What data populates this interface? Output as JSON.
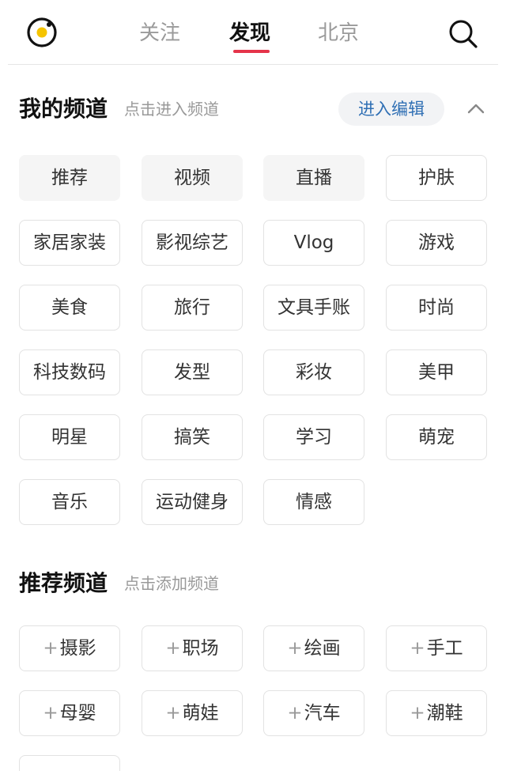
{
  "header": {
    "tabs": [
      {
        "label": "关注",
        "active": false
      },
      {
        "label": "发现",
        "active": true
      },
      {
        "label": "北京",
        "active": false
      }
    ],
    "accent_color": "#e5344a",
    "logo_color": "#f5c400"
  },
  "my_channels": {
    "title": "我的频道",
    "hint": "点击进入频道",
    "edit_label": "进入编辑",
    "channels": [
      {
        "label": "推荐",
        "filled": true
      },
      {
        "label": "视频",
        "filled": true
      },
      {
        "label": "直播",
        "filled": true
      },
      {
        "label": "护肤",
        "filled": false
      },
      {
        "label": "家居家装",
        "filled": false
      },
      {
        "label": "影视综艺",
        "filled": false
      },
      {
        "label": "Vlog",
        "filled": false
      },
      {
        "label": "游戏",
        "filled": false
      },
      {
        "label": "美食",
        "filled": false
      },
      {
        "label": "旅行",
        "filled": false
      },
      {
        "label": "文具手账",
        "filled": false
      },
      {
        "label": "时尚",
        "filled": false
      },
      {
        "label": "科技数码",
        "filled": false
      },
      {
        "label": "发型",
        "filled": false
      },
      {
        "label": "彩妆",
        "filled": false
      },
      {
        "label": "美甲",
        "filled": false
      },
      {
        "label": "明星",
        "filled": false
      },
      {
        "label": "搞笑",
        "filled": false
      },
      {
        "label": "学习",
        "filled": false
      },
      {
        "label": "萌宠",
        "filled": false
      },
      {
        "label": "音乐",
        "filled": false
      },
      {
        "label": "运动健身",
        "filled": false
      },
      {
        "label": "情感",
        "filled": false
      }
    ]
  },
  "recommended_channels": {
    "title": "推荐频道",
    "hint": "点击添加频道",
    "plus": "+",
    "channels": [
      {
        "label": "摄影"
      },
      {
        "label": "职场"
      },
      {
        "label": "绘画"
      },
      {
        "label": "手工"
      },
      {
        "label": "母婴"
      },
      {
        "label": "萌娃"
      },
      {
        "label": "汽车"
      },
      {
        "label": "潮鞋"
      }
    ]
  }
}
